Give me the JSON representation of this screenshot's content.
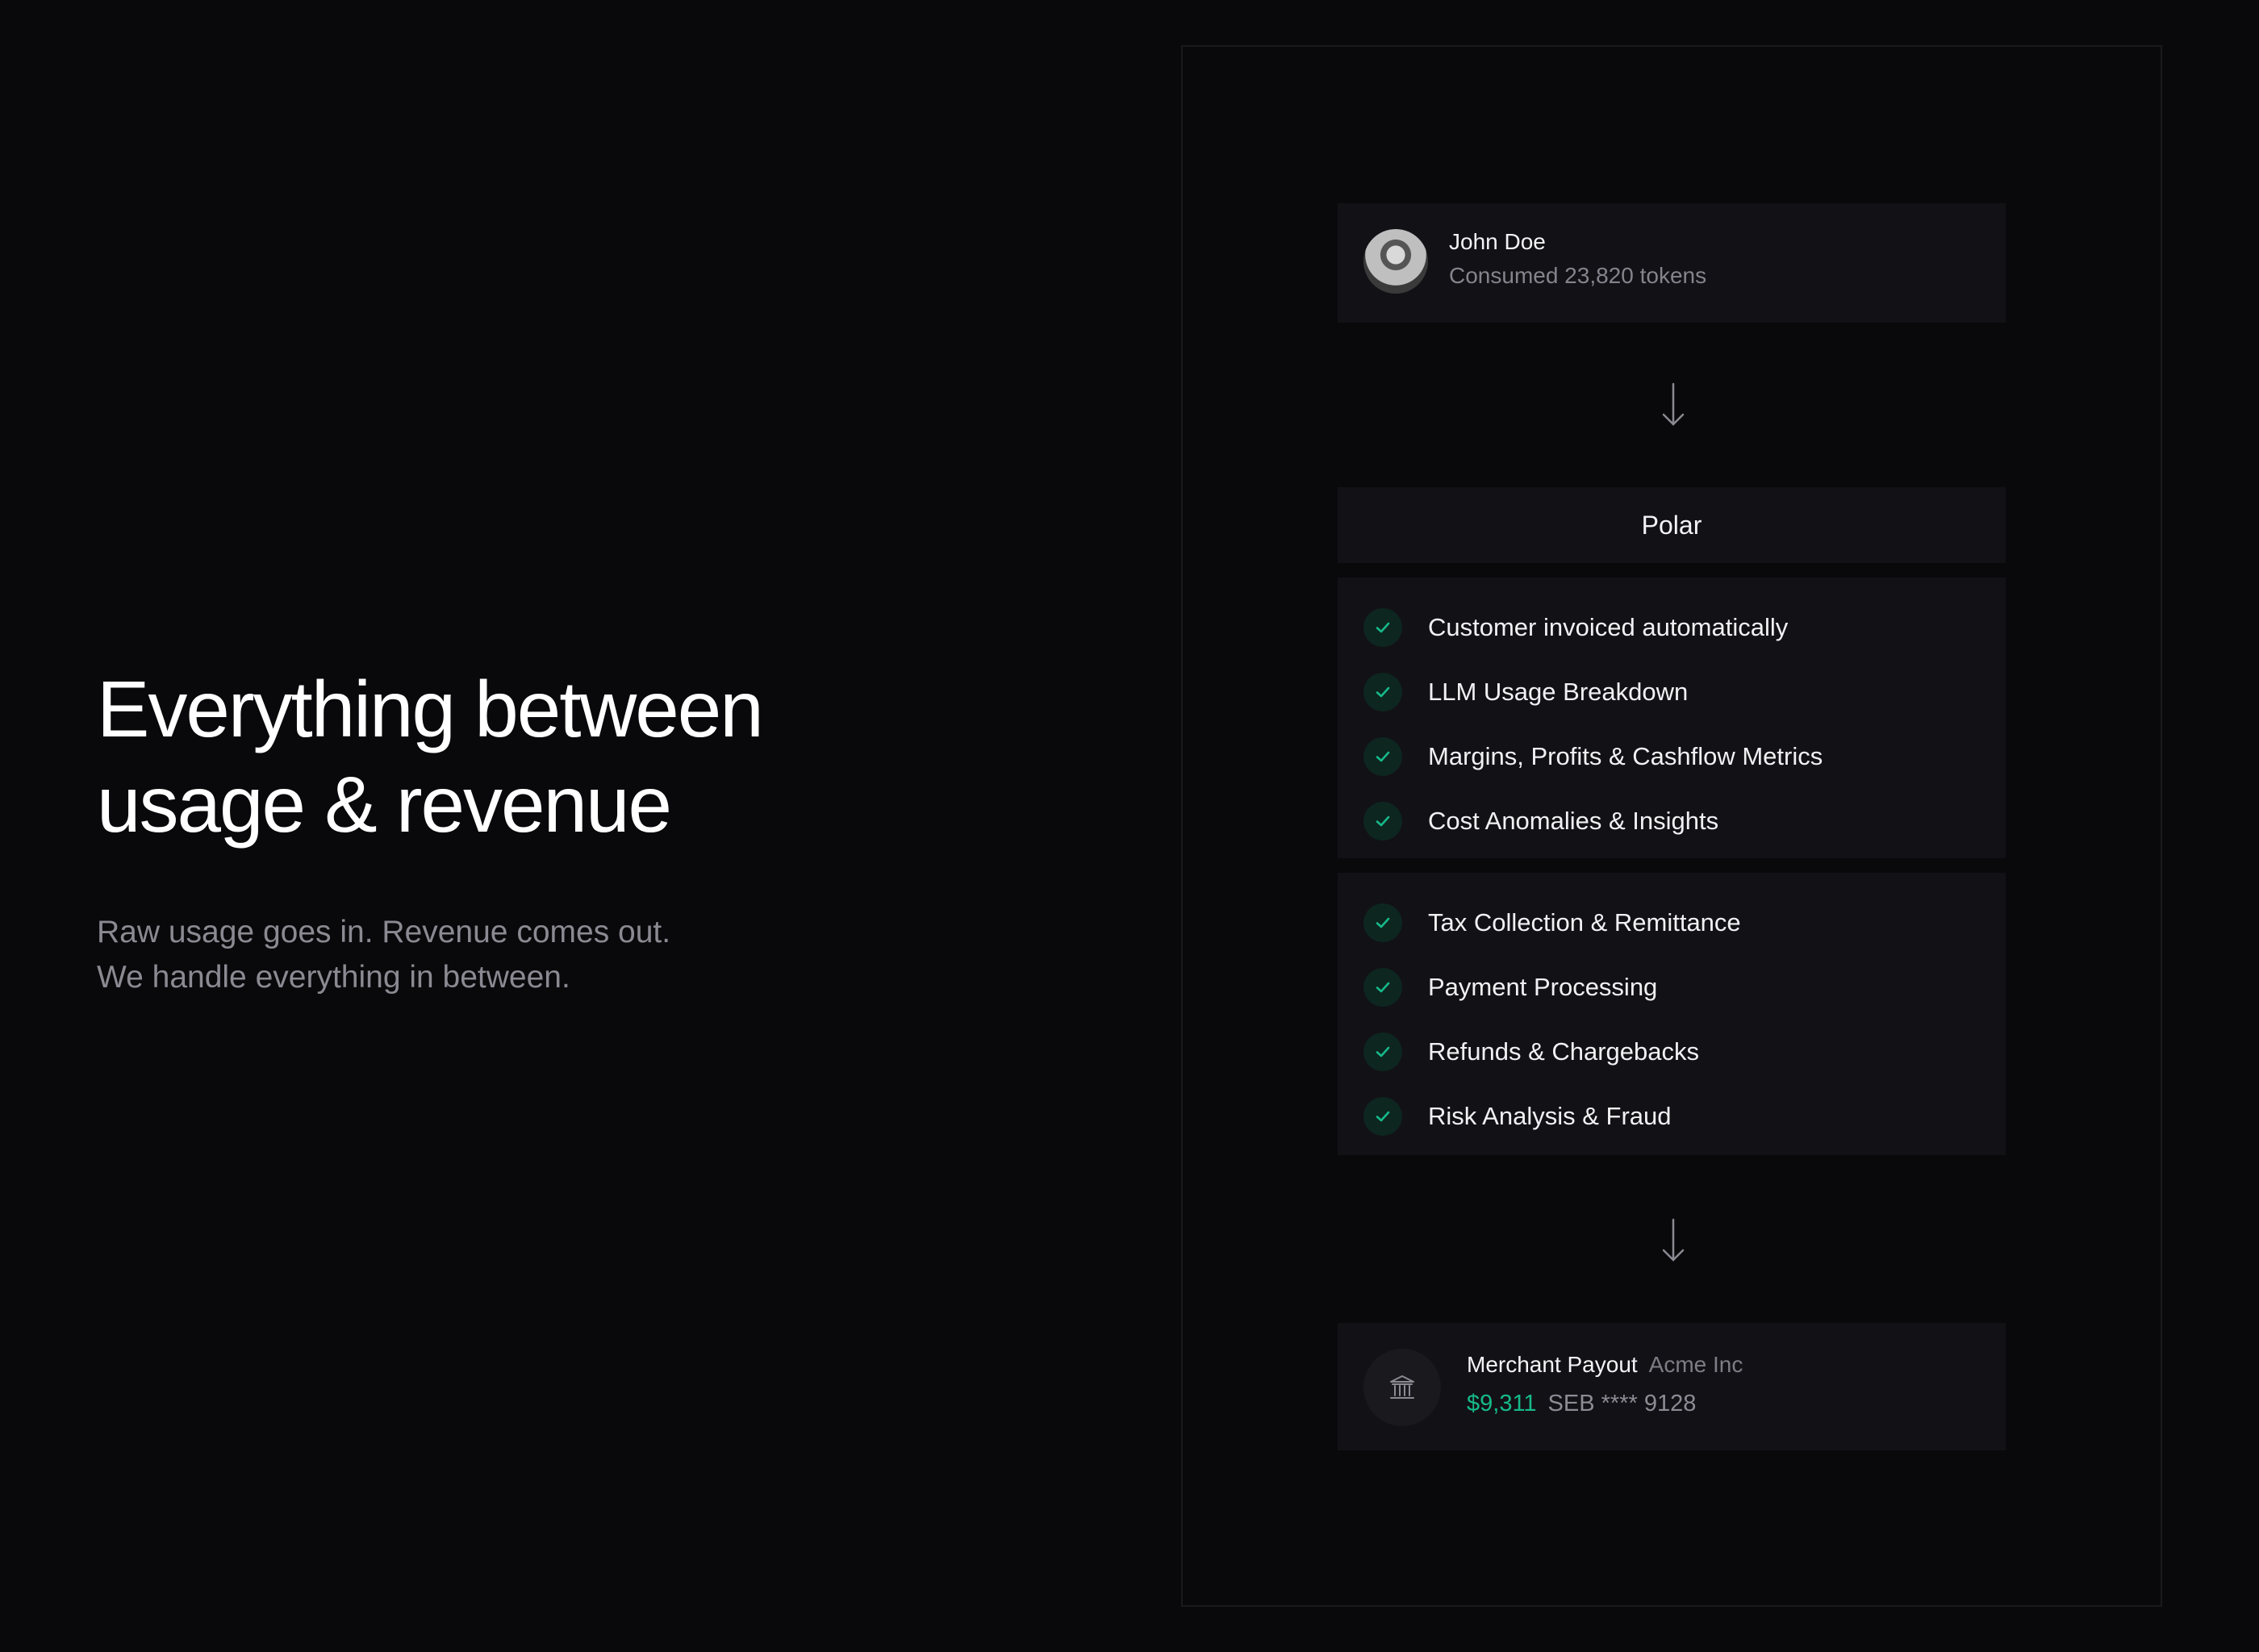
{
  "hero": {
    "title": "Everything between usage & revenue",
    "subtitle": "Raw usage goes in. Revenue comes out. We handle everything in between."
  },
  "customer": {
    "name": "John Doe",
    "consumption": "Consumed 23,820 tokens"
  },
  "platform": {
    "name": "Polar"
  },
  "features_group_1": [
    {
      "label": "Customer invoiced automatically"
    },
    {
      "label": "LLM Usage Breakdown"
    },
    {
      "label": "Margins, Profits & Cashflow Metrics"
    },
    {
      "label": "Cost Anomalies & Insights"
    }
  ],
  "features_group_2": [
    {
      "label": "Tax Collection & Remittance"
    },
    {
      "label": "Payment Processing"
    },
    {
      "label": "Refunds & Chargebacks"
    },
    {
      "label": "Risk Analysis & Fraud"
    }
  ],
  "payout": {
    "title": "Merchant Payout",
    "merchant": "Acme Inc",
    "amount": "$9,311",
    "account": "SEB **** 9128"
  },
  "icons": {
    "check": "check-icon",
    "arrow": "arrow-down-icon",
    "bank": "bank-icon",
    "avatar": "avatar"
  },
  "colors": {
    "background": "#09080b",
    "card": "#121116",
    "accent": "#16b98a",
    "check_bg": "#0d2620"
  }
}
